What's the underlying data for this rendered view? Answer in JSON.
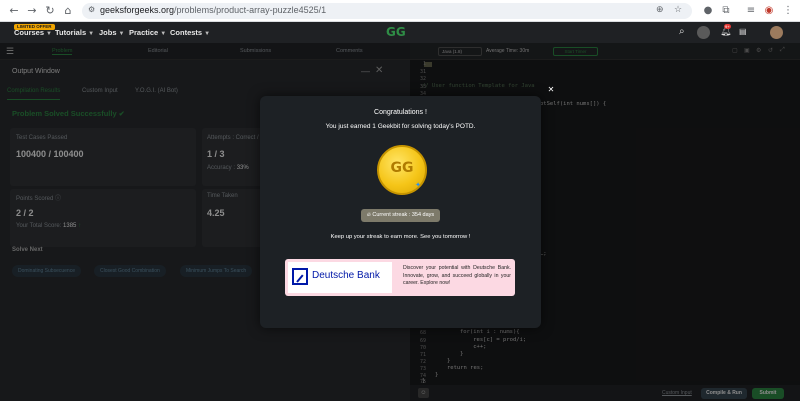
{
  "browser": {
    "url_host": "geeksforgeeks.org",
    "url_path": "/problems/product-array-puzzle4525/1"
  },
  "site": {
    "courses_badge": "LIMITED OFFER",
    "menu": [
      "Courses",
      "Tutorials",
      "Jobs",
      "Practice",
      "Contests"
    ],
    "notification_count": "9+"
  },
  "tabs": [
    "Problem",
    "Editorial",
    "Submissions",
    "Comments"
  ],
  "editor_bar": {
    "language": "Java (1.8)",
    "avg_time": "Average Time: 30m",
    "timer": "Start Timer"
  },
  "output": {
    "title": "Output Window",
    "subtabs": [
      "Compilation Results",
      "Custom Input",
      "Y.O.G.I. (AI Bot)"
    ],
    "status": "Problem Solved Successfully",
    "test_cases_label": "Test Cases Passed",
    "test_cases_value": "100400 / 100400",
    "attempts_label": "Attempts : Correct / Total",
    "attempts_value": "1 / 3",
    "accuracy_label": "Accuracy :",
    "accuracy_value": "33%",
    "points_label": "Points Scored",
    "points_value": "2 / 2",
    "total_score_label": "Your Total Score:",
    "total_score_value": "1385",
    "time_label": "Time Taken",
    "time_value": "4.25",
    "solve_next_label": "Solve Next",
    "solve_next": [
      "Dominating Subsecuence",
      "Closest Good Combination",
      "Minimum Jumps To Search"
    ]
  },
  "code": {
    "line_numbers_top": [
      "1",
      "31",
      "32",
      "33",
      "34"
    ],
    "line_numbers_bottom": [
      "68",
      "69",
      "70",
      "71",
      "72",
      "73",
      "74",
      "75"
    ],
    "comment": "// User function Template for Java",
    "sig": "ptSelf(int nums[]) {",
    "mid": "…;",
    "lines_bottom": [
      "for(int i : nums){",
      "    res[c] = prod/i;",
      "    c++;",
      "}",
      "}",
      "return res;",
      "}",
      "}"
    ]
  },
  "footer": {
    "custom_input": "Custom Input",
    "compile": "Compile & Run",
    "submit": "Submit"
  },
  "modal": {
    "title": "Congratulations !",
    "subtitle": "You just earned 1 Geekbit for solving today's POTD.",
    "streak": "Current streak : 354 days",
    "message": "Keep up your streak to earn more. See you tomorrow !",
    "ad_brand": "Deutsche Bank",
    "ad_text": "Discover your potential with Deutsche Bank. Innovate, grow, and succeed globally in your career. Explore now!"
  }
}
